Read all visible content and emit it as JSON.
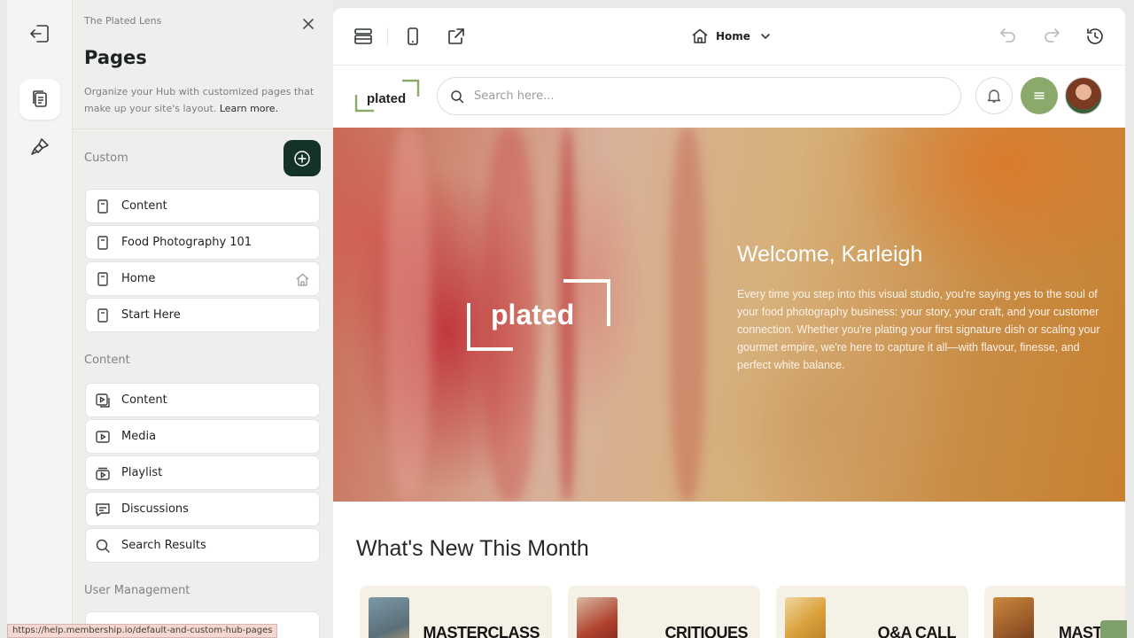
{
  "rail": {
    "items": [
      {
        "name": "exit-icon"
      },
      {
        "name": "pages-icon",
        "active": true
      },
      {
        "name": "design-brush-icon"
      }
    ]
  },
  "panel": {
    "site_name": "The Plated Lens",
    "title": "Pages",
    "description": "Organize your Hub with customized pages that make up your site's layout.",
    "learn_more": "Learn more.",
    "sections": {
      "custom": "Custom",
      "content": "Content",
      "user_management": "User Management"
    },
    "custom_pages": [
      {
        "label": "Content",
        "icon": "page-icon"
      },
      {
        "label": "Food Photography 101",
        "icon": "page-icon"
      },
      {
        "label": "Home",
        "icon": "page-icon",
        "is_home": true
      },
      {
        "label": "Start Here",
        "icon": "page-icon"
      }
    ],
    "content_pages": [
      {
        "label": "Content",
        "icon": "content-play-icon"
      },
      {
        "label": "Media",
        "icon": "media-icon"
      },
      {
        "label": "Playlist",
        "icon": "playlist-icon"
      },
      {
        "label": "Discussions",
        "icon": "chat-icon"
      },
      {
        "label": "Search Results",
        "icon": "search-icon"
      }
    ]
  },
  "status_url": "https://help.membership.io/default-and-custom-hub-pages",
  "toolbar": {
    "current_page": "Home"
  },
  "site": {
    "logo_text": "plated",
    "search_placeholder": "Search here...",
    "hero": {
      "title": "Welcome, Karleigh",
      "text": "Every time you step into this visual studio, you're saying yes to the soul of your food photography business: your story, your craft, and your customer connection. Whether you're plating your first signature dish or scaling your gourmet empire, we're here to capture it all—with flavour, finesse, and perfect white balance."
    },
    "whats_new_title": "What's New This Month",
    "cards": [
      {
        "label": "MASTERCLASS",
        "thumb_color": "#6f8a96"
      },
      {
        "label": "CRITIQUES",
        "thumb_color": "#b0432f"
      },
      {
        "label": "Q&A CALL",
        "thumb_color": "#d9a03a"
      },
      {
        "label": "MASTE",
        "thumb_color": "#9c5a2a"
      }
    ]
  },
  "colors": {
    "accent_dark": "#14322a",
    "accent_green": "#8aa96b"
  }
}
